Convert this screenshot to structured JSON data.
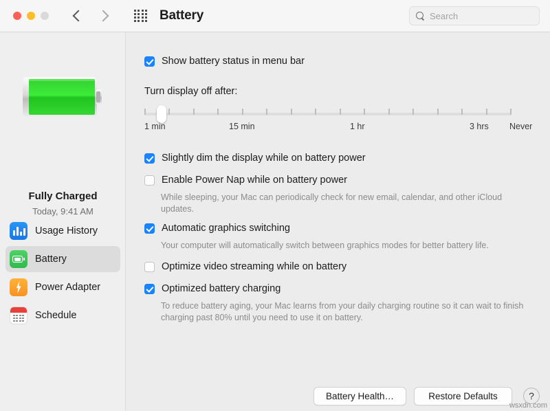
{
  "window": {
    "title": "Battery",
    "traffic_lights": [
      "close",
      "minimize",
      "zoom"
    ]
  },
  "toolbar": {
    "back_icon": "chevron-left-icon",
    "forward_icon": "chevron-right-icon",
    "grid_icon": "show-all-grid-icon",
    "search_placeholder": "Search"
  },
  "sidebar": {
    "battery_art": "battery-full-green-icon",
    "status_title": "Fully Charged",
    "status_subtitle": "Today, 9:41 AM",
    "items": [
      {
        "label": "Usage History",
        "icon": "usage-history-icon",
        "selected": false
      },
      {
        "label": "Battery",
        "icon": "battery-icon",
        "selected": true
      },
      {
        "label": "Power Adapter",
        "icon": "power-adapter-icon",
        "selected": false
      },
      {
        "label": "Schedule",
        "icon": "schedule-icon",
        "selected": false
      }
    ]
  },
  "main": {
    "show_battery_status": {
      "label": "Show battery status in menu bar",
      "checked": true
    },
    "display_off": {
      "label": "Turn display off after:",
      "value": "1 min",
      "tick_count": 16,
      "knob_position_percent": 3.5,
      "scale_labels": [
        "1 min",
        "15 min",
        "1 hr",
        "3 hrs",
        "Never"
      ]
    },
    "options": [
      {
        "label": "Slightly dim the display while on battery power",
        "checked": true,
        "help": ""
      },
      {
        "label": "Enable Power Nap while on battery power",
        "checked": false,
        "help": "While sleeping, your Mac can periodically check for new email, calendar, and other iCloud updates."
      },
      {
        "label": "Automatic graphics switching",
        "checked": true,
        "help": "Your computer will automatically switch between graphics modes for better battery life."
      },
      {
        "label": "Optimize video streaming while on battery",
        "checked": false,
        "help": ""
      },
      {
        "label": "Optimized battery charging",
        "checked": true,
        "help": "To reduce battery aging, your Mac learns from your daily charging routine so it can wait to finish charging past 80% until you need to use it on battery."
      }
    ],
    "buttons": {
      "battery_health": "Battery Health…",
      "restore_defaults": "Restore Defaults",
      "help": "?"
    }
  },
  "watermark": "wsxdn.com",
  "colors": {
    "accent_blue": "#1a84fc",
    "battery_green": "#3ecc4f",
    "window_bg": "#ececec",
    "sidebar_bg": "#efeff0"
  }
}
